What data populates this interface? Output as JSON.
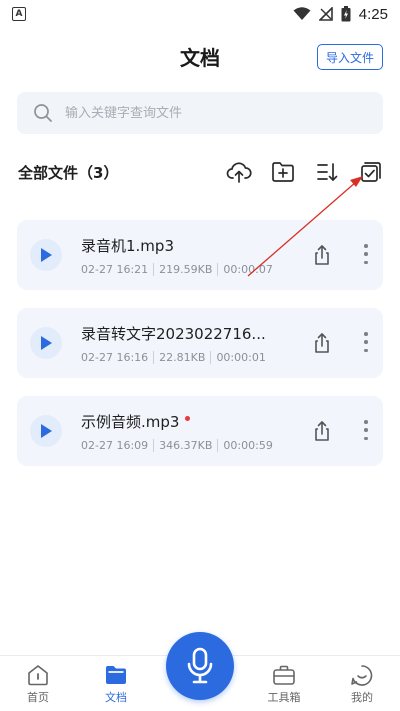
{
  "status_bar": {
    "time": "4:25",
    "app_indicator": "A"
  },
  "header": {
    "title": "文档",
    "import_label": "导入文件"
  },
  "search": {
    "placeholder": "输入关键字查询文件"
  },
  "section": {
    "title": "全部文件（3）"
  },
  "toolbar": {
    "icons": [
      "cloud-upload-icon",
      "new-folder-icon",
      "sort-icon",
      "multi-select-icon"
    ]
  },
  "files": [
    {
      "name": "录音机1.mp3",
      "date": "02-27 16:21",
      "size": "219.59KB",
      "duration": "00:00:07",
      "is_new": false
    },
    {
      "name": "录音转文字2023022716...",
      "date": "02-27 16:16",
      "size": "22.81KB",
      "duration": "00:00:01",
      "is_new": false
    },
    {
      "name": "示例音频.mp3",
      "date": "02-27 16:09",
      "size": "346.37KB",
      "duration": "00:00:59",
      "is_new": true
    }
  ],
  "nav": {
    "items": [
      {
        "label": "首页",
        "icon": "home-icon",
        "active": false
      },
      {
        "label": "文档",
        "icon": "folder-icon",
        "active": true
      },
      {
        "label": "工具箱",
        "icon": "toolbox-icon",
        "active": false
      },
      {
        "label": "我的",
        "icon": "profile-icon",
        "active": false
      }
    ],
    "center_icon": "microphone-icon"
  },
  "colors": {
    "accent": "#2c6ae0",
    "card_bg": "#f2f6fc",
    "annotation": "#d93025",
    "new_dot": "#e83a3a"
  }
}
